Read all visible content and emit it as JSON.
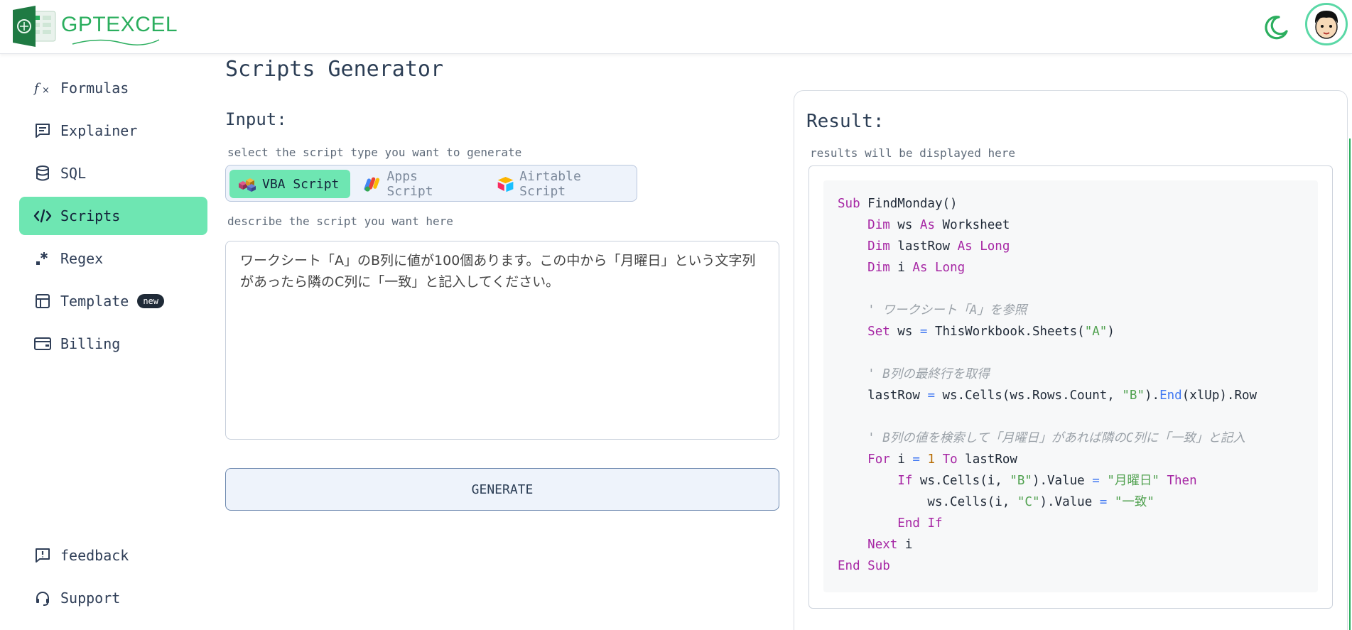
{
  "app": {
    "logo_text": "GPTEXCEL",
    "brand_color": "#2bae5e",
    "accent_color": "#6ee6b2"
  },
  "header": {
    "theme_toggle_icon": "moon-icon",
    "avatar_icon": "user-avatar"
  },
  "sidebar": {
    "items": [
      {
        "label": "Formulas",
        "icon": "function-icon"
      },
      {
        "label": "Explainer",
        "icon": "chat-lines-icon"
      },
      {
        "label": "SQL",
        "icon": "database-icon"
      },
      {
        "label": "Scripts",
        "icon": "code-icon",
        "active": true
      },
      {
        "label": "Regex",
        "icon": "regex-icon"
      },
      {
        "label": "Template",
        "icon": "table-icon",
        "badge": "new"
      },
      {
        "label": "Billing",
        "icon": "wallet-icon"
      }
    ],
    "footer_items": [
      {
        "label": "feedback",
        "icon": "feedback-icon"
      },
      {
        "label": "Support",
        "icon": "headset-icon"
      }
    ]
  },
  "main": {
    "title": "Scripts Generator",
    "input_label": "Input:",
    "type_hint": "select the script type you want to generate",
    "script_types": [
      {
        "label": "VBA Script",
        "icon": "vba-blocks-icon",
        "selected": true
      },
      {
        "label": "Apps Script",
        "icon": "apps-script-icon",
        "selected": false
      },
      {
        "label": "Airtable Script",
        "icon": "airtable-icon",
        "selected": false
      }
    ],
    "describe_hint": "describe the script you want here",
    "description": "ワークシート「A」のB列に値が100個あります。この中から「月曜日」という文字列があったら隣のC列に「一致」と記入してください。",
    "generate_label": "GENERATE"
  },
  "result": {
    "title": "Result:",
    "hint": "results will be displayed here",
    "code_language": "vba",
    "code_lines": [
      "Sub FindMonday()",
      "    Dim ws As Worksheet",
      "    Dim lastRow As Long",
      "    Dim i As Long",
      "",
      "    ' ワークシート「A」を参照",
      "    Set ws = ThisWorkbook.Sheets(\"A\")",
      "",
      "    ' B列の最終行を取得",
      "    lastRow = ws.Cells(ws.Rows.Count, \"B\").End(xlUp).Row",
      "",
      "    ' B列の値を検索して「月曜日」があれば隣のC列に「一致」と記入",
      "    For i = 1 To lastRow",
      "        If ws.Cells(i, \"B\").Value = \"月曜日\" Then",
      "            ws.Cells(i, \"C\").Value = \"一致\"",
      "        End If",
      "    Next i",
      "End Sub"
    ]
  }
}
